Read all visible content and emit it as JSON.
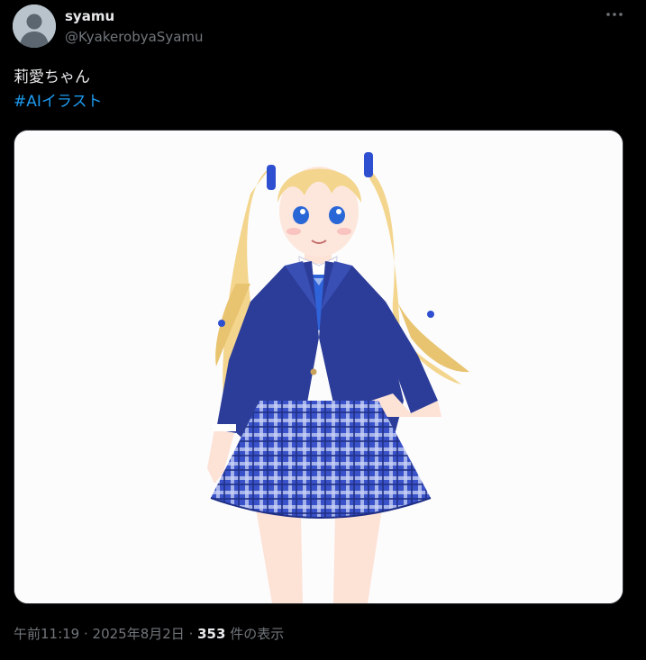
{
  "author": {
    "display_name": "syamu",
    "handle": "@KyakerobyaSyamu",
    "avatar_icon": "default-avatar-icon"
  },
  "more_menu": {
    "icon": "more-horizontal-icon"
  },
  "tweet": {
    "text": "莉愛ちゃん",
    "hashtag": "#AIイラスト"
  },
  "media": {
    "icon": "anime-illustration-image"
  },
  "meta": {
    "time": "午前11:19",
    "separator1": " · ",
    "date": "2025年8月2日",
    "separator2": " · ",
    "views_count": "353",
    "views_label": " 件の表示"
  },
  "colors": {
    "background": "#000000",
    "text": "#e7e9ea",
    "secondary": "#71767b",
    "link": "#1d9bf0"
  }
}
